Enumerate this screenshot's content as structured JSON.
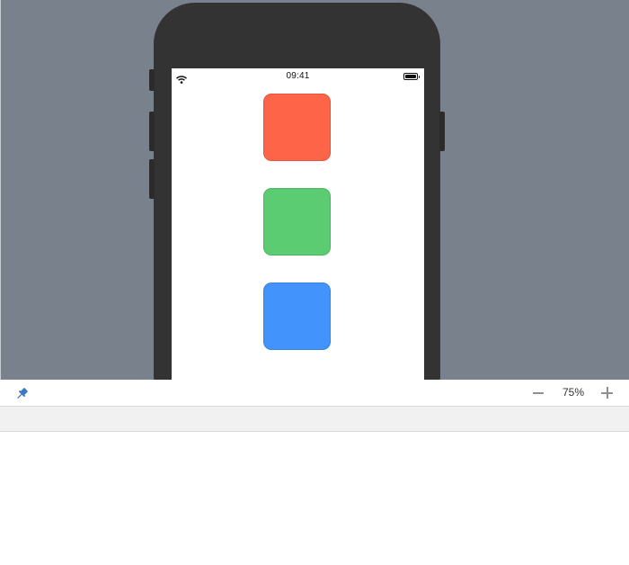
{
  "device": {
    "status_bar": {
      "time": "09:41",
      "wifi_icon": "wifi-icon",
      "battery_icon": "battery-icon"
    },
    "tiles": [
      {
        "name": "red-square",
        "color": "#fe6447"
      },
      {
        "name": "green-square",
        "color": "#5bcc71"
      },
      {
        "name": "blue-square",
        "color": "#4294fc"
      }
    ]
  },
  "toolbar": {
    "pin_icon": "pin-icon",
    "zoom_out_icon": "minus-icon",
    "zoom_level": "75%",
    "zoom_in_icon": "plus-icon"
  },
  "colors": {
    "canvas_background": "#78818c",
    "device_frame": "#333333",
    "screen_background": "#ffffff",
    "pin_accent": "#3a78c2"
  }
}
